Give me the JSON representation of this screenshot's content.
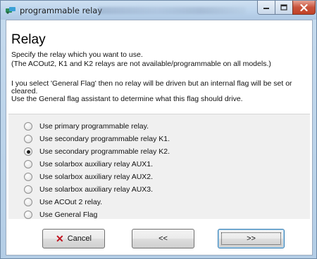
{
  "window": {
    "title": "programmable relay",
    "icon": "relay-app-icon",
    "controls": {
      "minimize": "minimize-icon",
      "maximize": "maximize-icon",
      "close": "close-icon"
    }
  },
  "page": {
    "heading": "Relay",
    "instructions": [
      "Specify the relay which you want to use.",
      "(The ACOut2, K1 and K2 relays are not available/programmable on all models.)",
      "I  you select 'General Flag' then no relay will be driven but an internal flag will be set or",
      "cleared.",
      "Use the General flag assistant to determine what this flag should drive."
    ]
  },
  "options": [
    {
      "label": "Use primary programmable relay.",
      "selected": false
    },
    {
      "label": "Use secondary programmable relay K1.",
      "selected": false
    },
    {
      "label": "Use secondary programmable relay K2.",
      "selected": true
    },
    {
      "label": "Use solarbox auxiliary relay AUX1.",
      "selected": false
    },
    {
      "label": "Use solarbox auxiliary relay AUX2.",
      "selected": false
    },
    {
      "label": "Use solarbox auxiliary relay AUX3.",
      "selected": false
    },
    {
      "label": "Use ACOut 2 relay.",
      "selected": false
    },
    {
      "label": "Use General Flag",
      "selected": false
    }
  ],
  "buttons": {
    "cancel": "Cancel",
    "back": "<<",
    "next": ">>"
  },
  "colors": {
    "cancel_icon": "#c1121f",
    "close_button": "#c8533c"
  }
}
